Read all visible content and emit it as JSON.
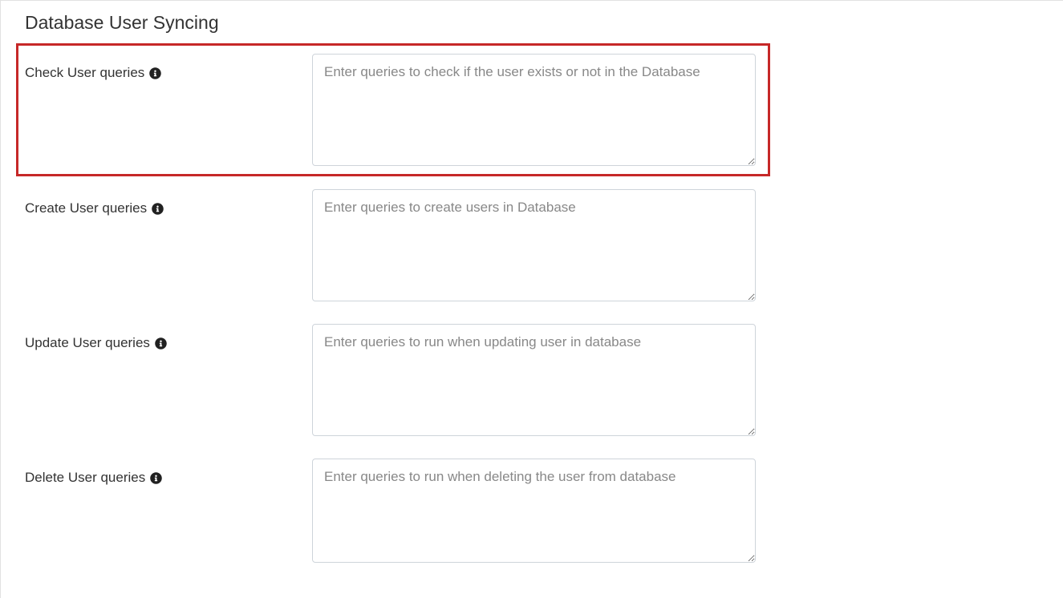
{
  "section": {
    "title": "Database User Syncing"
  },
  "fields": {
    "check_user": {
      "label": "Check User queries",
      "placeholder": "Enter queries to check if the user exists or not in the Database"
    },
    "create_user": {
      "label": "Create User queries",
      "placeholder": "Enter queries to create users in Database"
    },
    "update_user": {
      "label": "Update User queries",
      "placeholder": "Enter queries to run when updating user in database"
    },
    "delete_user": {
      "label": "Delete User queries",
      "placeholder": "Enter queries to run when deleting the user from database"
    }
  }
}
